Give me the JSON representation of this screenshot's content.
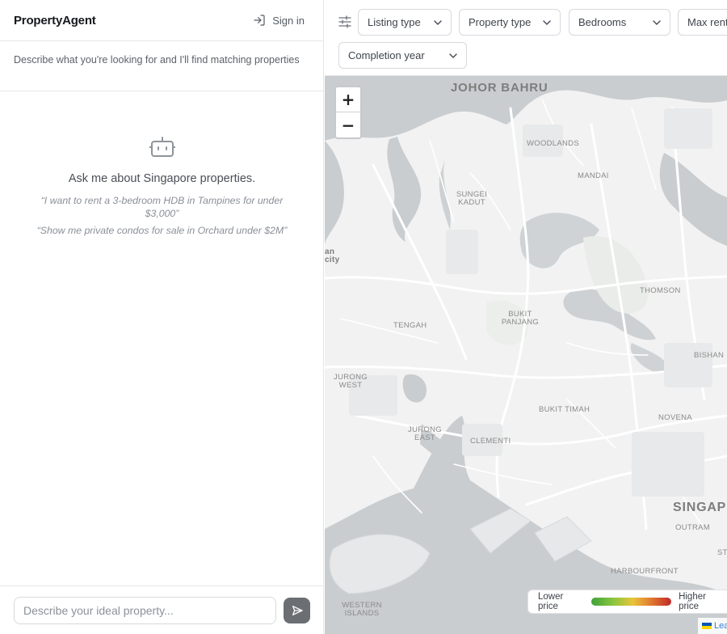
{
  "app": {
    "brand": "PropertyAgent",
    "sign_in_label": "Sign in"
  },
  "intro": {
    "text": "Describe what you're looking for and I'll find matching properties"
  },
  "empty_state": {
    "icon": "robot-icon",
    "title": "Ask me about Singapore properties.",
    "examples": [
      "“I want to rent a 3-bedroom HDB in Tampines for under $3,000”",
      "“Show me private condos for sale in Orchard under $2M”"
    ]
  },
  "composer": {
    "placeholder": "Describe your ideal property..."
  },
  "filters": {
    "icon": "sliders-icon",
    "items": [
      {
        "label": "Listing type"
      },
      {
        "label": "Property type"
      },
      {
        "label": "Bedrooms"
      },
      {
        "label": "Max rent"
      },
      {
        "label": "Completion year"
      }
    ]
  },
  "map": {
    "zoom_in": "+",
    "zoom_out": "−",
    "places": {
      "johor_bahru": "JOHOR BAHRU",
      "woodlands": "WOODLANDS",
      "mandai": "MANDAI",
      "sungei_kadut": "SUNGEI KADUT",
      "thomson": "THOMSON",
      "bukit_panjang": "BUKIT PANJANG",
      "tengah": "TENGAH",
      "bishan": "BISHAN",
      "jurong_west": "JURONG WEST",
      "bukit_timah": "BUKIT TIMAH",
      "novena": "NOVENA",
      "jurong_east": "JURONG EAST",
      "clementi": "CLEMENTI",
      "singapore": "SINGAP",
      "outram": "OUTRAM",
      "harbourfront": "HARBOURFRONT",
      "western_islands": "WESTERN ISLANDS",
      "edge_left": "an city",
      "edge_st": "ST"
    },
    "legend": {
      "low": "Lower price",
      "high": "Higher price"
    },
    "attribution": "Leaflet",
    "colors": {
      "water": "#c9cdd0",
      "land": "#f2f2f2",
      "low": "#3fa33a",
      "high": "#c0282a"
    }
  }
}
